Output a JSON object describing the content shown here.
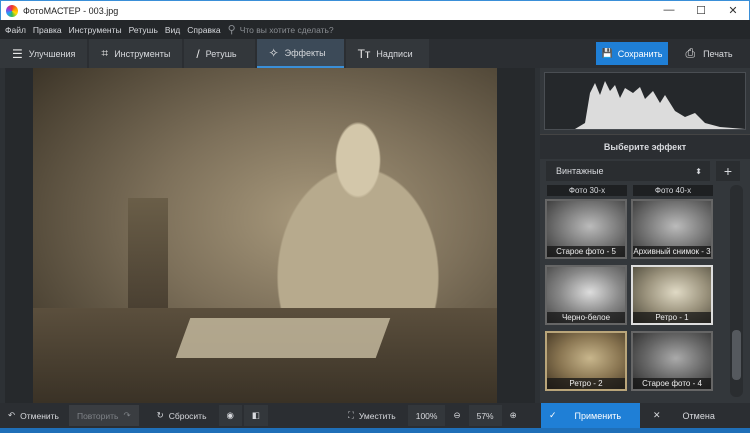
{
  "window": {
    "title": "ФотоМАСТЕР - 003.jpg",
    "minimize": "—",
    "maximize": "☐",
    "close": "✕"
  },
  "menu": {
    "items": [
      "Файл",
      "Правка",
      "Инструменты",
      "Ретушь",
      "Вид",
      "Справка"
    ],
    "search_placeholder": "Что вы хотите сделать?"
  },
  "tabs": [
    {
      "label": "Улучшения",
      "icon": "☰"
    },
    {
      "label": "Инструменты",
      "icon": "⌗"
    },
    {
      "label": "Ретушь",
      "icon": "/"
    },
    {
      "label": "Эффекты",
      "icon": "✧"
    },
    {
      "label": "Надписи",
      "icon": "Tт"
    }
  ],
  "actions": {
    "save": "Сохранить",
    "print": "Печать"
  },
  "panel": {
    "title": "Выберите эффект",
    "category": "Винтажные",
    "columns": [
      "Фото 30-х",
      "Фото 40-х"
    ],
    "effects": [
      "Старое фото - 5",
      "Архивный снимок - 3",
      "Черно-белое",
      "Ретро - 1",
      "Ретро - 2",
      "Старое фото - 4"
    ],
    "selected": "Ретро - 2"
  },
  "bottom": {
    "undo": "Отменить",
    "redo": "Повторить",
    "reset": "Сбросить",
    "fit": "Уместить",
    "zoom100": "100%",
    "zoom": "57%",
    "apply": "Применить",
    "cancel": "Отмена"
  },
  "colors": {
    "accent": "#1f7fd6"
  }
}
